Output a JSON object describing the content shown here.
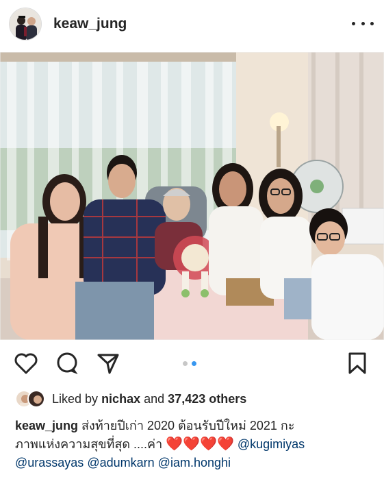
{
  "post": {
    "username": "keaw_jung",
    "more_icon": "more-horizontal-icon"
  },
  "carousel": {
    "slides": 2,
    "active": 2
  },
  "likes": {
    "prefix": "Liked by",
    "liker": "nichax",
    "middle": "and",
    "count": "37,423 others"
  },
  "caption": {
    "username": "keaw_jung",
    "line1": "ส่งท้ายปีเก่า 2020 ต้อนรับปีใหม่  2021 กะ",
    "line2_text": "ภาพแห่งความสุขที่สุด ....ค่า",
    "hearts": [
      "❤️",
      "❤️",
      "❤️",
      "❤️"
    ],
    "mentions": [
      "@kugimiyas",
      "@urassayas",
      "@adumkarn",
      "@iam.honghi"
    ]
  },
  "colors": {
    "link": "#00376b",
    "accent": "#3897f0",
    "heart": "#ed2b3a"
  }
}
